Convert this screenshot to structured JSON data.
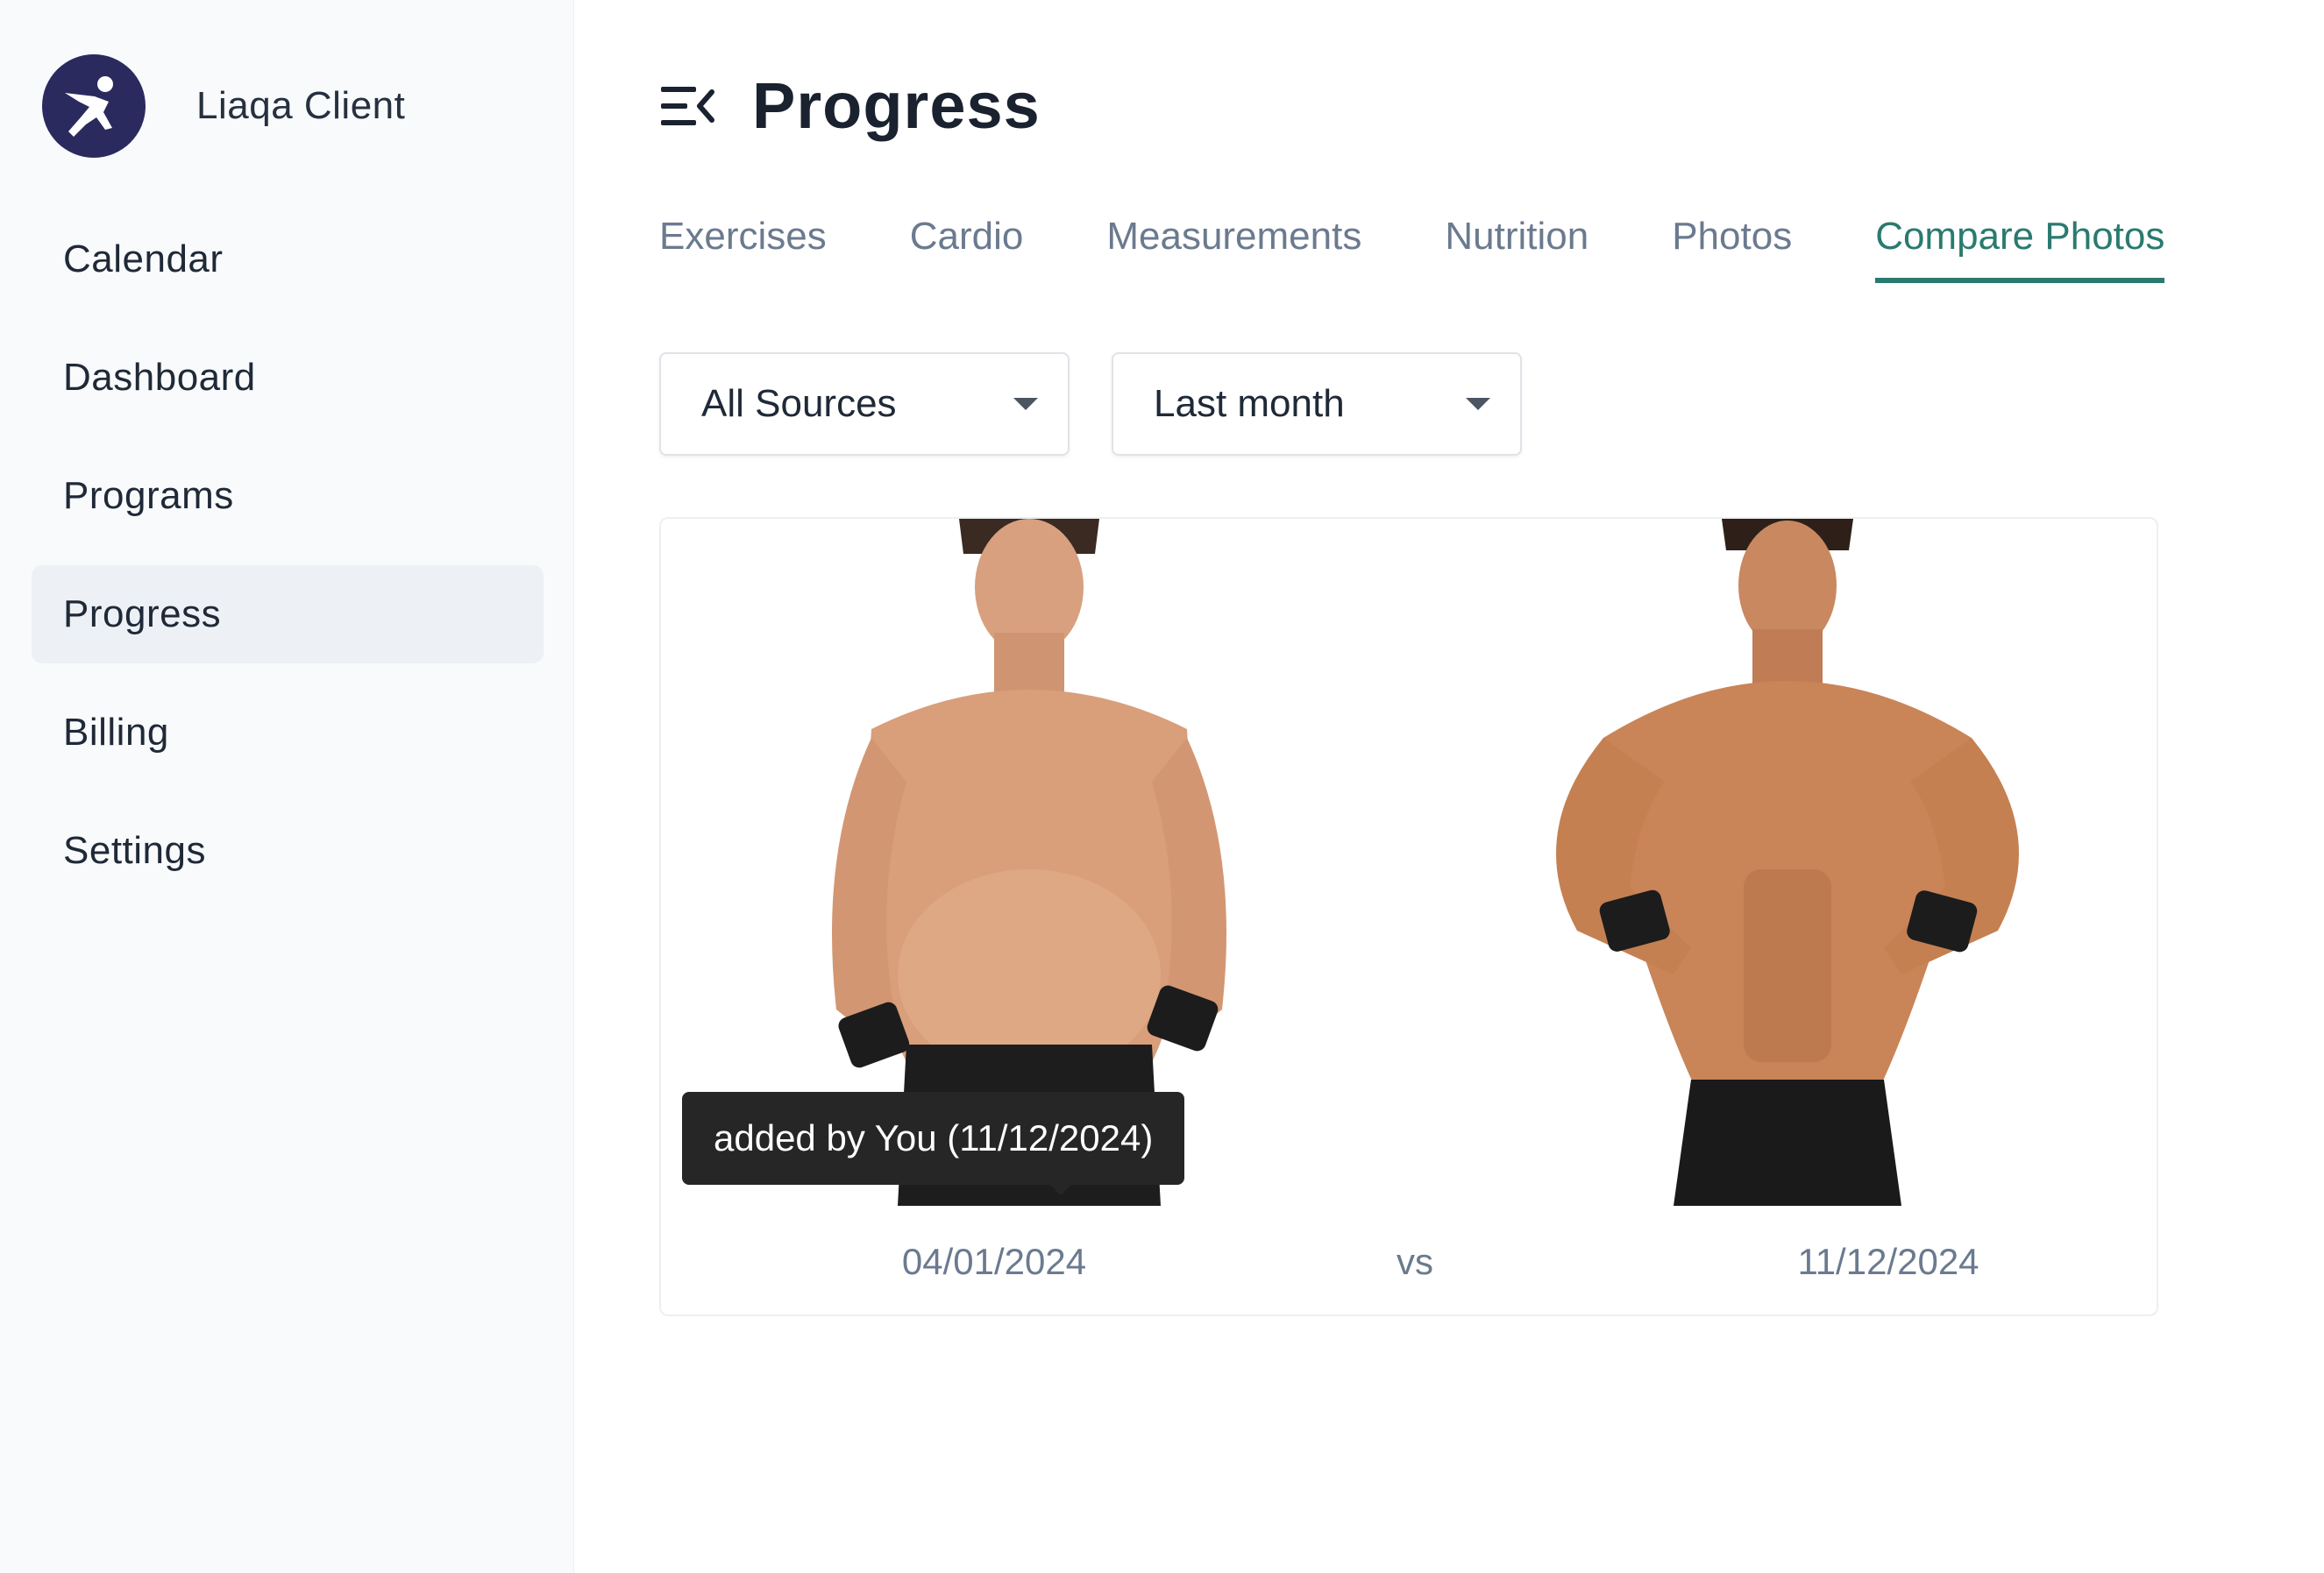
{
  "brand": {
    "name": "Liaqa Client"
  },
  "sidebar": {
    "items": [
      {
        "label": "Calendar"
      },
      {
        "label": "Dashboard"
      },
      {
        "label": "Programs"
      },
      {
        "label": "Progress"
      },
      {
        "label": "Billing"
      },
      {
        "label": "Settings"
      }
    ],
    "active": "Progress"
  },
  "header": {
    "title": "Progress",
    "toggle_icon": "collapse-menu-icon"
  },
  "tabs": [
    {
      "label": "Exercises"
    },
    {
      "label": "Cardio"
    },
    {
      "label": "Measurements"
    },
    {
      "label": "Nutrition"
    },
    {
      "label": "Photos"
    },
    {
      "label": "Compare Photos"
    }
  ],
  "active_tab": "Compare Photos",
  "filters": {
    "source": {
      "value": "All Sources"
    },
    "period": {
      "value": "Last month"
    }
  },
  "compare": {
    "tooltip": "added by You (11/12/2024)",
    "before_date": "04/01/2024",
    "vs": "vs",
    "after_date": "11/12/2024"
  },
  "colors": {
    "accent": "#2a7a6f",
    "logo": "#2a2a5e",
    "active_nav_bg": "#edf1f5"
  }
}
